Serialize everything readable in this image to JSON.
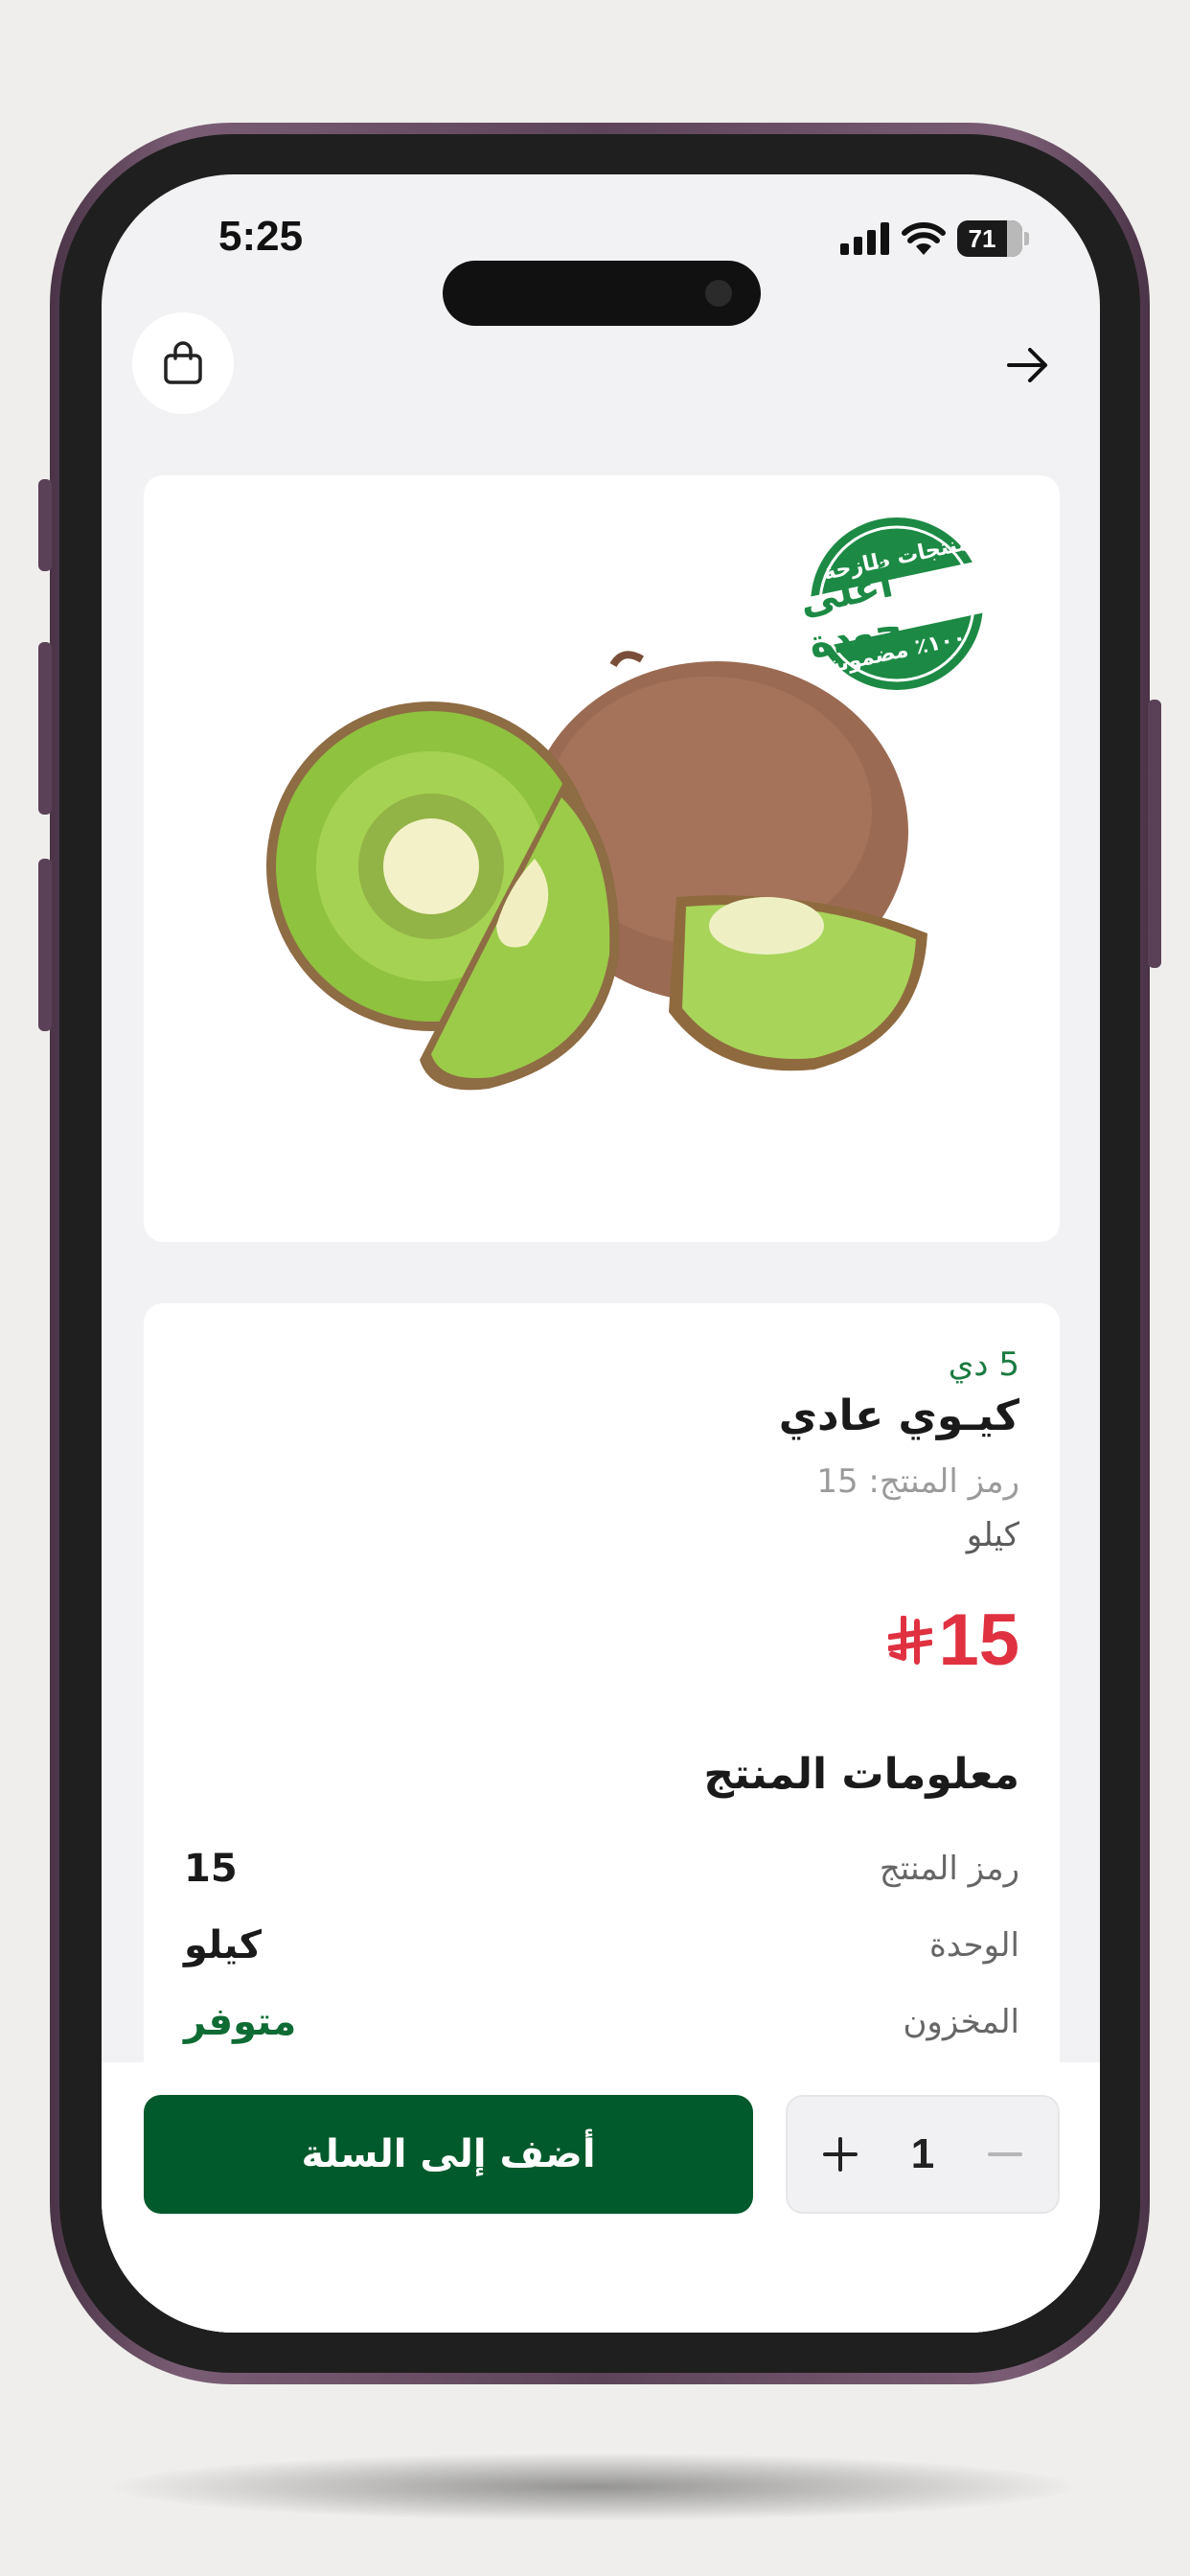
{
  "status_bar": {
    "time": "5:25",
    "battery": "71",
    "icons": [
      "signal-icon",
      "wifi-icon",
      "battery-icon"
    ]
  },
  "header": {
    "cart_icon": "shopping-bag-icon",
    "back_icon": "arrow-right-icon"
  },
  "product_image": {
    "description_icon": "kiwi-image",
    "badge": {
      "top_text": "منتجات طازجة",
      "main_text": "أعلى جودة",
      "bottom_text": "١٠٠٪ مضمونة"
    }
  },
  "product": {
    "brand": "5 دي",
    "name": "كيـوي عادي",
    "code_line": "رمز المنتج: 15",
    "unit": "كيلو",
    "price": "15",
    "currency_symbol": "⃁"
  },
  "product_info": {
    "title": "معلومات المنتج",
    "rows": [
      {
        "label": "رمز المنتج",
        "value": "15"
      },
      {
        "label": "الوحدة",
        "value": "كيلو"
      },
      {
        "label": "المخزون",
        "value": "متوفر"
      }
    ]
  },
  "actions": {
    "add_to_cart": "أضف إلى السلة",
    "quantity": "1"
  },
  "colors": {
    "primary_green": "#005a2b",
    "price_red": "#e03141",
    "brand_green": "#1a7a40"
  }
}
